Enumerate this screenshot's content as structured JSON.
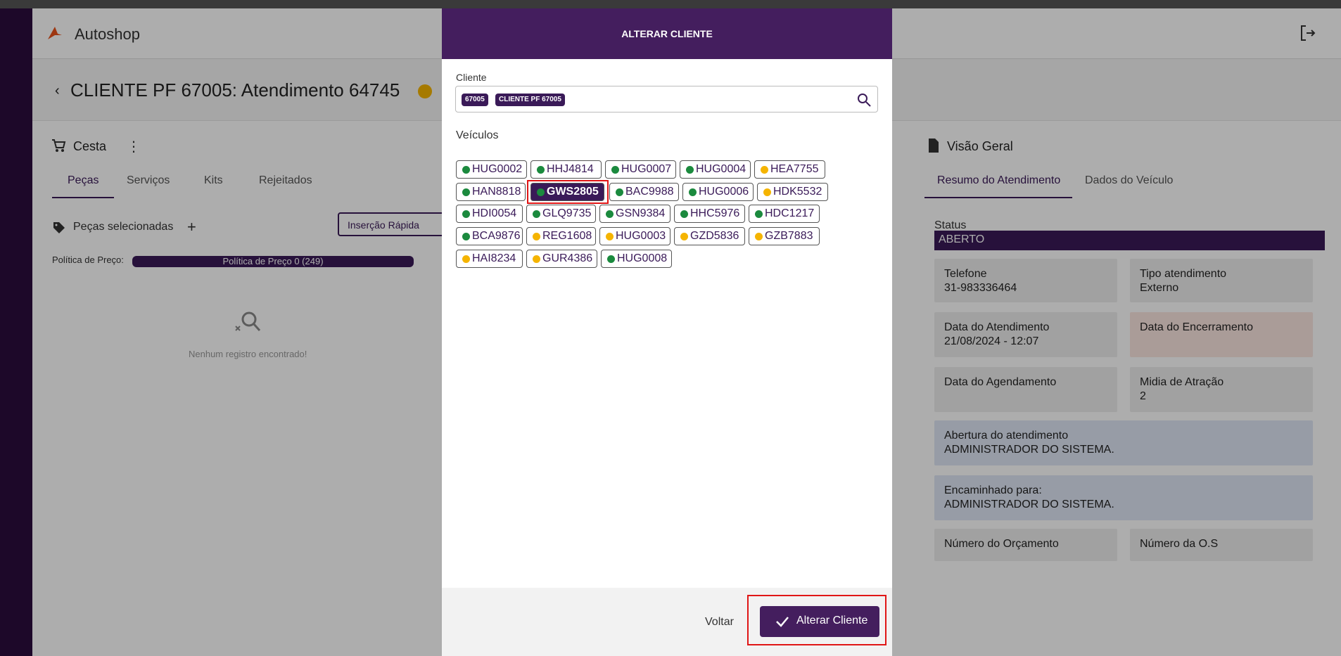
{
  "app": {
    "title": "Autoshop"
  },
  "page": {
    "title": "CLIENTE PF 67005: Atendimento 64745"
  },
  "cesta": {
    "title": "Cesta",
    "tabs": [
      "Peças",
      "Serviços",
      "Kits",
      "Rejeitados"
    ],
    "pecas_selecionadas": "Peças selecionadas",
    "insercao_rapida": "Inserção Rápida",
    "politica_label": "Política de Preço:",
    "politica_value": "Política de Preço 0 (249)",
    "empty_text": "Nenhum registro encontrado!"
  },
  "visao": {
    "title": "Visão Geral",
    "tabs": [
      "Resumo do Atendimento",
      "Dados do Veículo"
    ],
    "status_label": "Status",
    "status_value": "ABERTO",
    "cards": [
      {
        "label": "Telefone",
        "value": "31-983336464"
      },
      {
        "label": "Tipo atendimento",
        "value": "Externo"
      },
      {
        "label": "Data do Atendimento",
        "value": "21/08/2024 - 12:07"
      },
      {
        "label": "Data do Encerramento",
        "value": ""
      },
      {
        "label": "Data do Agendamento",
        "value": ""
      },
      {
        "label": "Midia de Atração",
        "value": "2"
      },
      {
        "label": "Abertura do atendimento",
        "value": "ADMINISTRADOR DO SISTEMA."
      },
      {
        "label": "Encaminhado para:",
        "value": "ADMINISTRADOR DO SISTEMA."
      },
      {
        "label": "Número do Orçamento",
        "value": ""
      },
      {
        "label": "Número da O.S",
        "value": ""
      }
    ]
  },
  "modal": {
    "title": "ALTERAR CLIENTE",
    "cliente_label": "Cliente",
    "cliente_chips": [
      "67005",
      "CLIENTE PF 67005"
    ],
    "veiculos_label": "Veículos",
    "vehicles": [
      [
        {
          "plate": "HUG0002",
          "status": "green"
        },
        {
          "plate": "HHJ4814",
          "status": "green"
        },
        {
          "plate": "HUG0007",
          "status": "green"
        },
        {
          "plate": "HUG0004",
          "status": "green"
        },
        {
          "plate": "HEA7755",
          "status": "yellow"
        }
      ],
      [
        {
          "plate": "HAN8818",
          "status": "green"
        },
        {
          "plate": "GWS2805",
          "status": "green",
          "selected": true
        },
        {
          "plate": "BAC9988",
          "status": "green"
        },
        {
          "plate": "HUG0006",
          "status": "green"
        },
        {
          "plate": "HDK5532",
          "status": "yellow"
        }
      ],
      [
        {
          "plate": "HDI0054",
          "status": "green"
        },
        {
          "plate": "GLQ9735",
          "status": "green"
        },
        {
          "plate": "GSN9384",
          "status": "green"
        },
        {
          "plate": "HHC5976",
          "status": "green"
        },
        {
          "plate": "HDC1217",
          "status": "green"
        }
      ],
      [
        {
          "plate": "BCA9876",
          "status": "green"
        },
        {
          "plate": "REG1608",
          "status": "yellow"
        },
        {
          "plate": "HUG0003",
          "status": "yellow"
        },
        {
          "plate": "GZD5836",
          "status": "yellow"
        },
        {
          "plate": "GZB7883",
          "status": "yellow"
        }
      ],
      [
        {
          "plate": "HAI8234",
          "status": "yellow"
        },
        {
          "plate": "GUR4386",
          "status": "yellow"
        },
        {
          "plate": "HUG0008",
          "status": "green"
        }
      ]
    ],
    "voltar": "Voltar",
    "alterar": "Alterar Cliente"
  },
  "colors": {
    "primary": "#441e5e",
    "green": "#1b8a3e",
    "yellow": "#f5b400",
    "highlight": "#e01616"
  }
}
